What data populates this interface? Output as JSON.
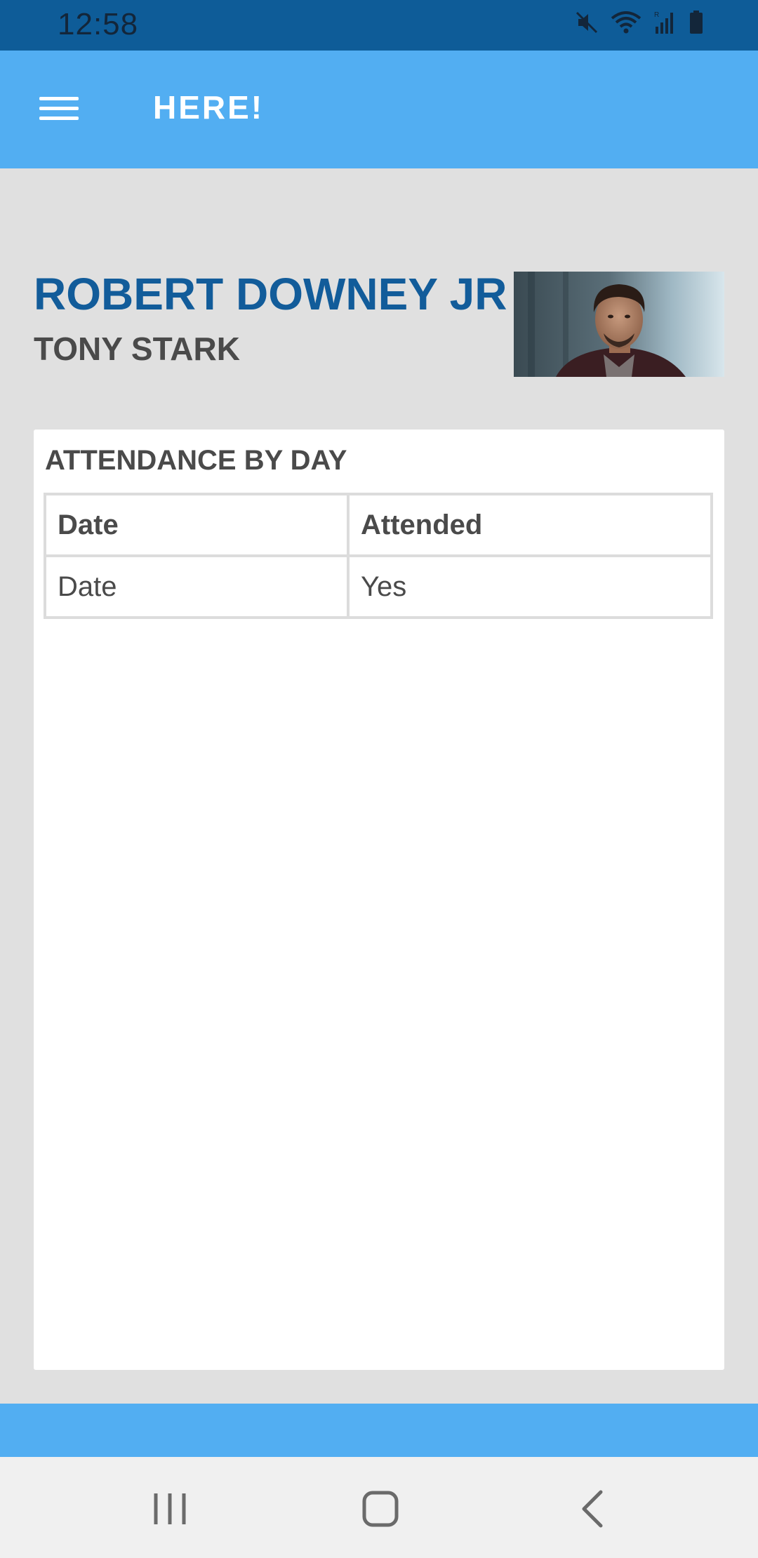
{
  "status_bar": {
    "time": "12:58",
    "icons": [
      "mute-icon",
      "wifi-icon",
      "signal-icon",
      "battery-icon"
    ]
  },
  "app_bar": {
    "title": "HERE!",
    "menu_icon": "hamburger-menu-icon"
  },
  "profile": {
    "name": "ROBERT DOWNEY JR",
    "role": "TONY STARK",
    "photo_description": "portrait-photo"
  },
  "attendance_card": {
    "title": "ATTENDANCE BY DAY",
    "columns": [
      "Date",
      "Attended"
    ],
    "rows": [
      [
        "Date",
        "Yes"
      ]
    ]
  },
  "nav_bar": {
    "buttons": [
      "recents-icon",
      "home-icon",
      "back-icon"
    ]
  },
  "colors": {
    "status_bar": "#0e5c98",
    "app_bar": "#52aef2",
    "name_text": "#125c9a",
    "background": "#e0e0e0"
  }
}
